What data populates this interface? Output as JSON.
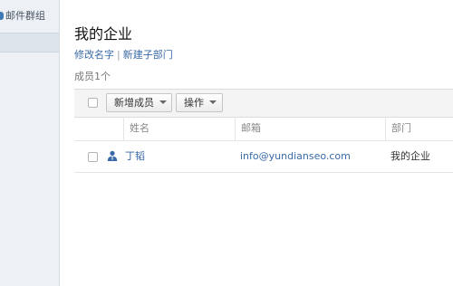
{
  "sidebar": {
    "items": [
      {
        "label": "邮件群组"
      },
      {
        "label": ""
      }
    ]
  },
  "org": {
    "title": "我的企业",
    "links": {
      "rename": "修改名字",
      "separator": "|",
      "new_sub_dept": "新建子部门"
    },
    "member_count": "成员1个"
  },
  "toolbar": {
    "add_member_label": "新增成员",
    "operations_label": "操作"
  },
  "table": {
    "columns": [
      "姓名",
      "邮箱",
      "部门"
    ],
    "rows": [
      {
        "name": "丁韬",
        "email": "info@yundianseo.com",
        "department": "我的企业"
      }
    ]
  },
  "colors": {
    "link": "#3a6aa8",
    "sidebar_bg": "#edf1f5",
    "toolbar_bg": "#f4f4f4"
  }
}
